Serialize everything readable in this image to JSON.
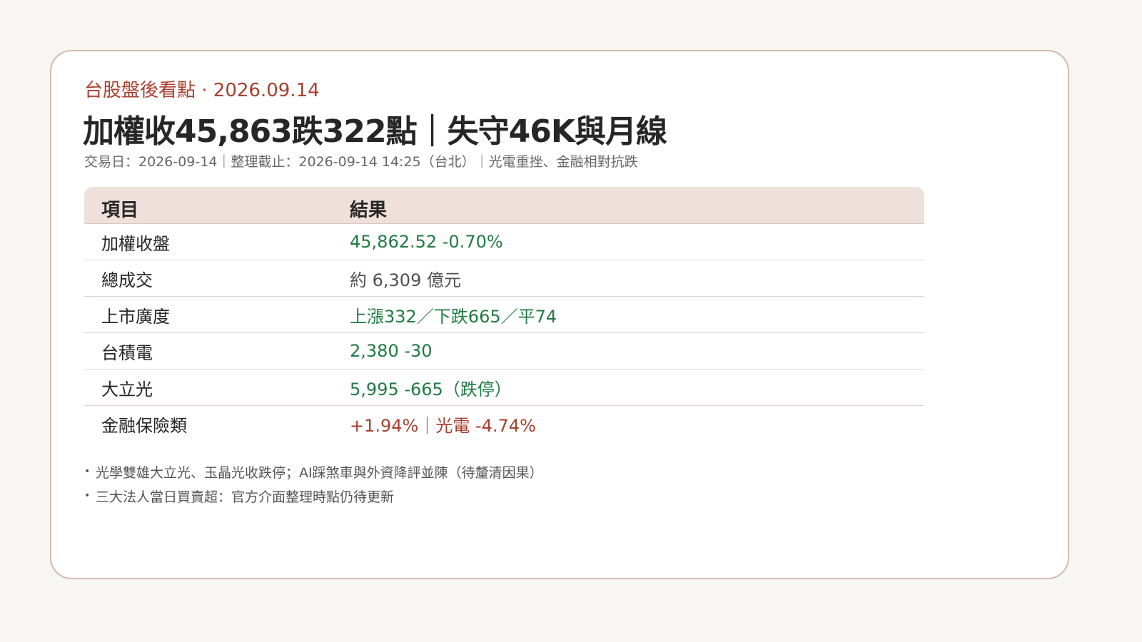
{
  "header": {
    "kicker": "台股盤後看點 · 2026.09.14",
    "title": "加權收45,863跌322點｜失守46K與月線",
    "meta": "交易日：2026-09-14｜整理截止：2026-09-14 14:25（台北）｜光電重挫、金融相對抗跌"
  },
  "table": {
    "headers": [
      "項目",
      "結果"
    ],
    "rows": [
      {
        "item": "加權收盤",
        "value": "45,862.52  -0.70%"
      },
      {
        "item": "總成交",
        "value": "約 6,309 億元"
      },
      {
        "item": "上市廣度",
        "value": "上漲332／下跌665／平74"
      },
      {
        "item": "台積電",
        "value": "2,380  -30"
      },
      {
        "item": "大立光",
        "value": "5,995  -665（跌停）"
      },
      {
        "item": "金融保險類",
        "value": "+1.94%｜光電 -4.74%"
      }
    ]
  },
  "notes": [
    "光學雙雄大立光、玉晶光收跌停；AI踩煞車與外資降評並陳（待釐清因果）",
    "三大法人當日買賣超：官方介面整理時點仍待更新"
  ],
  "colors": {
    "accent": "#a93f2e",
    "down": "#1f7a43",
    "neutral": "#505050",
    "header_bg": "#efe0dc",
    "card_border": "#d9b8ad"
  }
}
